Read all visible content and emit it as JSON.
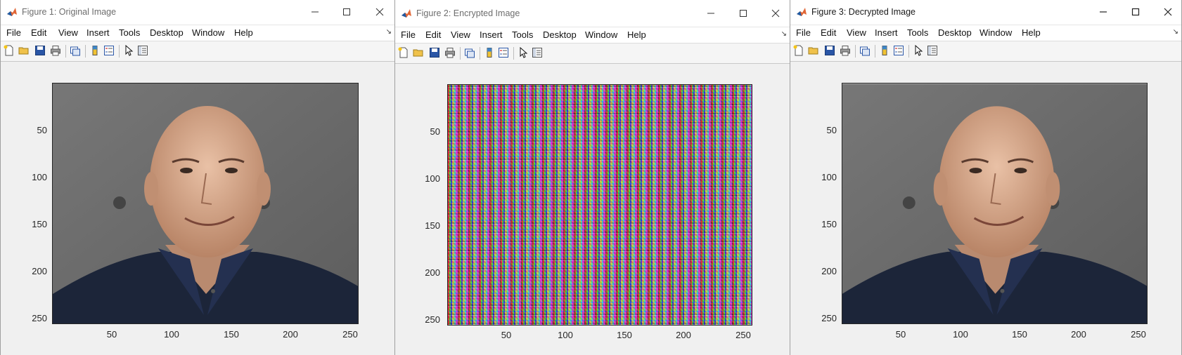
{
  "windows": [
    {
      "title": "Figure 1: Original Image",
      "image": "original-photo"
    },
    {
      "title": "Figure 2: Encrypted Image",
      "image": "encrypted-noise"
    },
    {
      "title": "Figure 3: Decrypted Image",
      "image": "decrypted-photo"
    }
  ],
  "menu": [
    "File",
    "Edit",
    "View",
    "Insert",
    "Tools",
    "Desktop",
    "Window",
    "Help"
  ],
  "toolbar_icons": [
    "new-figure-icon",
    "open-file-icon",
    "save-icon",
    "print-icon",
    "link-plot-icon",
    "insert-colorbar-icon",
    "insert-legend-icon",
    "edit-plot-arrow-icon",
    "property-inspector-icon"
  ],
  "axes": {
    "yticks": [
      "50",
      "100",
      "150",
      "200",
      "250"
    ],
    "xticks": [
      "50",
      "100",
      "150",
      "200",
      "250"
    ]
  },
  "colors": {
    "accent": "#0072bd",
    "window_bg": "#f0f0f0",
    "titlebar_bg": "#ffffff"
  }
}
